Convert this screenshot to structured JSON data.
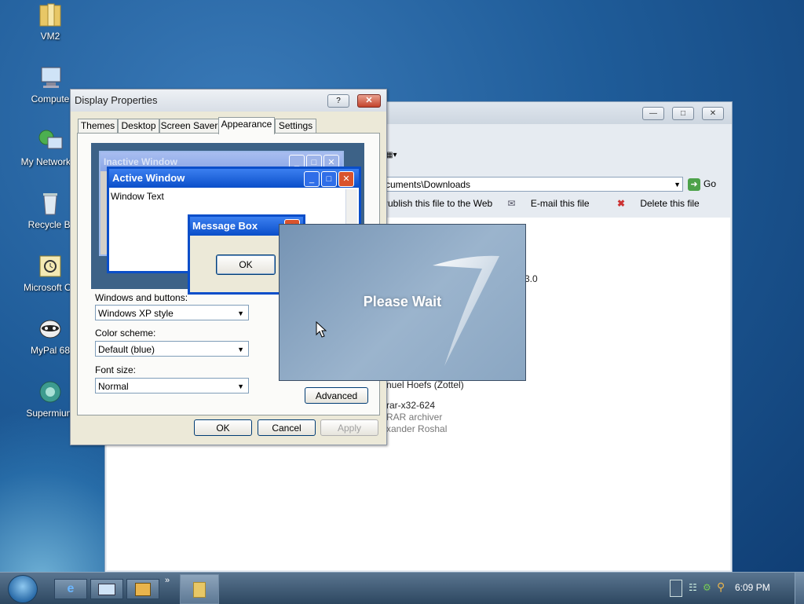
{
  "desktop": {
    "icons": [
      {
        "label": "VM2",
        "icon": "folder-icon"
      },
      {
        "label": "Compute",
        "icon": "computer-icon"
      },
      {
        "label": "My Network P",
        "icon": "network-icon"
      },
      {
        "label": "Recycle Bi",
        "icon": "recycle-bin-icon"
      },
      {
        "label": "Microsoft Ou",
        "icon": "outlook-icon"
      },
      {
        "label": "MyPal 68",
        "icon": "mypal-icon"
      },
      {
        "label": "Supermium",
        "icon": "supermium-icon"
      }
    ]
  },
  "explorer": {
    "address": "cuments\\Downloads",
    "go_label": "Go",
    "tasks": {
      "publish": "Publish this file to the Web",
      "email": "E-mail this file",
      "delete": "Delete this file"
    },
    "details": {
      "version_fragment": "3.0",
      "company_fragment": "nuel Hoefs (Zottel)",
      "file_fragment": "rar-x32-624",
      "desc_fragment": "RAR archiver",
      "author_fragment": "xander Roshal"
    }
  },
  "dialog": {
    "title": "Display Properties",
    "help": "?",
    "tabs": [
      "Themes",
      "Desktop",
      "Screen Saver",
      "Appearance",
      "Settings"
    ],
    "active_tab": "Appearance",
    "preview": {
      "inactive_title": "Inactive Window",
      "active_title": "Active Window",
      "window_text": "Window Text",
      "message_title": "Message Box",
      "ok": "OK"
    },
    "windows_buttons_label": "Windows and buttons:",
    "windows_buttons_value": "Windows XP style",
    "color_scheme_label": "Color scheme:",
    "color_scheme_value": "Default (blue)",
    "font_size_label": "Font size:",
    "font_size_value": "Normal",
    "advanced": "Advanced",
    "ok": "OK",
    "cancel": "Cancel",
    "apply": "Apply"
  },
  "splash": {
    "text": "Please Wait"
  },
  "taskbar": {
    "clock": "6:09 PM"
  },
  "colors": {
    "xp_blue": "#0a4ec9",
    "dialog_face": "#ece9d8",
    "close_red": "#c3432b"
  }
}
